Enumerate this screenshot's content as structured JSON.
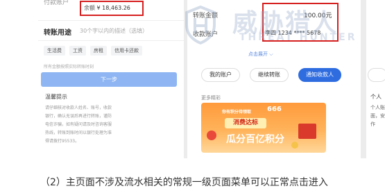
{
  "left_panel": {
    "top_cut_label": "付款账户",
    "balance_label": "余额",
    "balance_amount": "¥ 18,463.26",
    "purpose_label": "转账用途",
    "purpose_placeholder": "30个字以内的描述（选填）",
    "chips": [
      "生活费",
      "工资",
      "房租",
      "信用卡还款"
    ],
    "note": "所有金额按照实际转账时刻",
    "next_button": "下一步",
    "warm_title": "温馨提示",
    "warm_lines": [
      "请仔细核对收款人姓名、账号，收款",
      "银行，确认无误后再进行转账，谨防",
      "电信诈骗，如有疑问请及时咨询客服",
      "热线，转账到账时间以银行处理为准",
      "得请拨打95533。"
    ]
  },
  "right_panel": {
    "amount_label": "转账金额",
    "amount_value": "100.00元",
    "account_label": "收款账户",
    "account_value": "李四 1234 **** 5678",
    "expand_label": "点击展开",
    "actions": [
      "我的账户",
      "继续转账",
      "通知收款人"
    ],
    "more_label": "更多精彩",
    "banner": {
      "top_text": "你有积分待领取",
      "badge": "666",
      "pill_text": "消费达标",
      "main_text": "瓜分百亿积分"
    }
  },
  "edge_panel": {
    "lines": [
      "个人",
      "个人账",
      "面，安",
      "作"
    ]
  },
  "watermark": {
    "big": "威胁猎人",
    "small": "THREAT HUNTER"
  },
  "caption": "（2）主页面不涉及流水相关的常规一级页面菜单可以正常点击进入",
  "colors": {
    "highlight_red": "#d61f1f",
    "primary_blue": "#2e6ce0",
    "disabled_blue": "#8fb6f2"
  }
}
